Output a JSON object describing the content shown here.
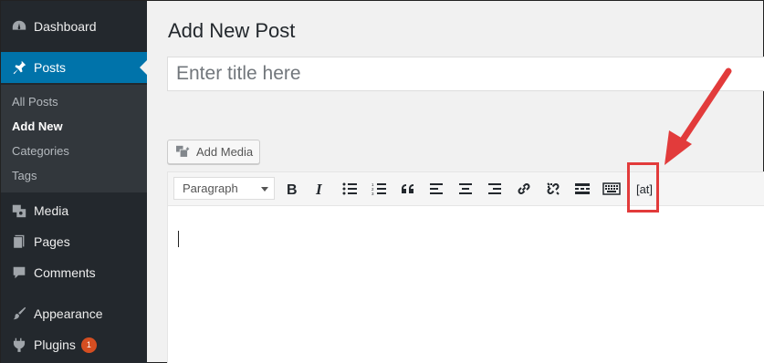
{
  "sidebar": {
    "items": [
      {
        "label": "Dashboard",
        "icon": "dashboard-icon"
      },
      {
        "label": "Posts",
        "icon": "pin-icon",
        "active": true
      },
      {
        "label": "Media",
        "icon": "media-icon"
      },
      {
        "label": "Pages",
        "icon": "pages-icon"
      },
      {
        "label": "Comments",
        "icon": "comment-icon"
      },
      {
        "label": "Appearance",
        "icon": "brush-icon"
      },
      {
        "label": "Plugins",
        "icon": "plug-icon",
        "badge": "1"
      }
    ],
    "submenu": [
      {
        "label": "All Posts"
      },
      {
        "label": "Add New",
        "current": true
      },
      {
        "label": "Categories"
      },
      {
        "label": "Tags"
      }
    ]
  },
  "main": {
    "page_title": "Add New Post",
    "title_placeholder": "Enter title here",
    "add_media_label": "Add Media",
    "format_select_value": "Paragraph",
    "shortcode_button_label": "[at]"
  },
  "colors": {
    "sidebar_bg": "#23282d",
    "active_bg": "#0073aa",
    "badge": "#d54e21",
    "annotation": "#e23b3b"
  }
}
